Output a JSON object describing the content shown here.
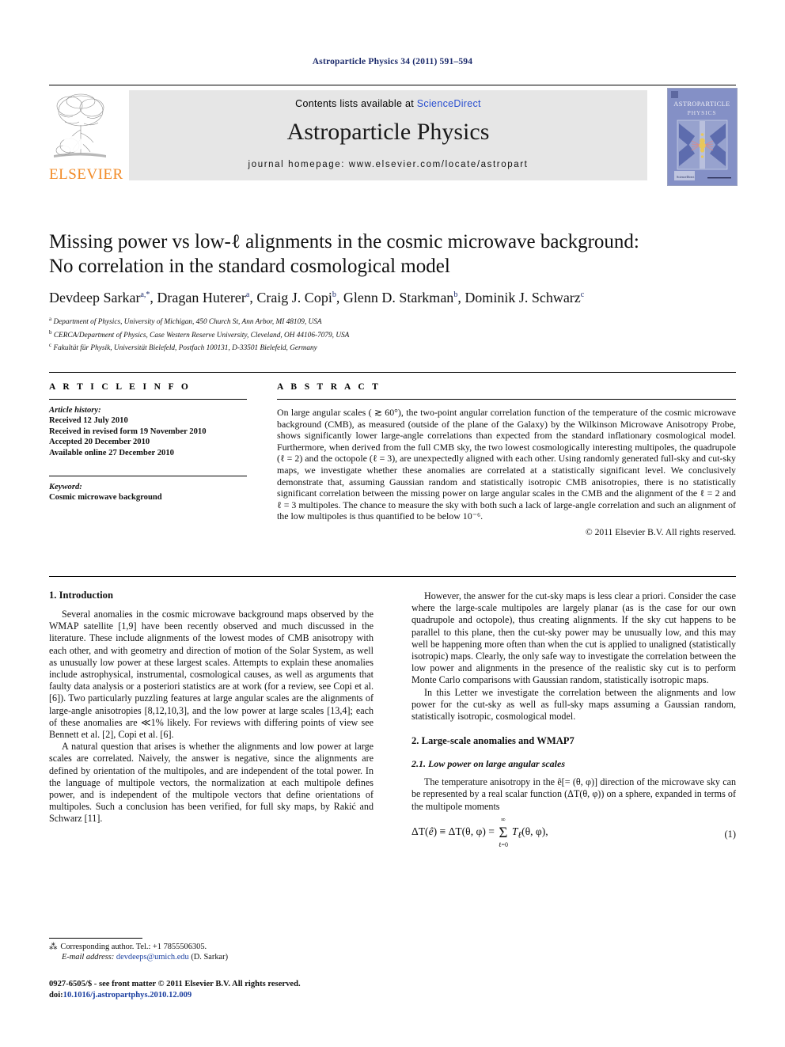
{
  "running_head": "Astroparticle Physics 34 (2011) 591–594",
  "masthead": {
    "publisher_name": "ELSEVIER",
    "contents_prefix": "Contents lists available at ",
    "contents_link": "ScienceDirect",
    "journal_title": "Astroparticle Physics",
    "homepage": "journal homepage: www.elsevier.com/locate/astropart",
    "cover_line1": "ASTROPARTICLE",
    "cover_line2": "PHYSICS",
    "cover_footer": "ScienceDirect"
  },
  "article": {
    "title_line1": "Missing power vs low-ℓ alignments in the cosmic microwave background:",
    "title_line2": "No correlation in the standard cosmological model",
    "authors": "Devdeep Sarkar, Dragan Huterer, Craig J. Copi, Glenn D. Starkman, Dominik J. Schwarz",
    "affiliations": [
      "Department of Physics, University of Michigan, 450 Church St, Ann Arbor, MI 48109, USA",
      "CERCA/Department of Physics, Case Western Reserve University, Cleveland, OH 44106-7079, USA",
      "Fakultät für Physik, Universität Bielefeld, Postfach 100131, D-33501 Bielefeld, Germany"
    ],
    "affiliation_marks": [
      "a",
      "b",
      "c"
    ]
  },
  "info": {
    "heading": "A R T I C L E    I N F O",
    "history_label": "Article history:",
    "history": [
      "Received 12 July 2010",
      "Received in revised form 19 November 2010",
      "Accepted 20 December 2010",
      "Available online 27 December 2010"
    ],
    "keyword_label": "Keyword:",
    "keywords": "Cosmic microwave background"
  },
  "abstract": {
    "heading": "A B S T R A C T",
    "text": "On large angular scales ( ≳ 60°), the two-point angular correlation function of the temperature of the cosmic microwave background (CMB), as measured (outside of the plane of the Galaxy) by the Wilkinson Microwave Anisotropy Probe, shows significantly lower large-angle correlations than expected from the standard inflationary cosmological model. Furthermore, when derived from the full CMB sky, the two lowest cosmologically interesting multipoles, the quadrupole (ℓ = 2) and the octopole (ℓ = 3), are unexpectedly aligned with each other. Using randomly generated full-sky and cut-sky maps, we investigate whether these anomalies are correlated at a statistically significant level. We conclusively demonstrate that, assuming Gaussian random and statistically isotropic CMB anisotropies, there is no statistically significant correlation between the missing power on large angular scales in the CMB and the alignment of the ℓ = 2 and ℓ = 3 multipoles. The chance to measure the sky with both such a lack of large-angle correlation and such an alignment of the low multipoles is thus quantified to be below 10⁻⁶.",
    "copyright": "© 2011 Elsevier B.V. All rights reserved."
  },
  "body": {
    "section1_heading": "1. Introduction",
    "left_paragraphs": [
      "Several anomalies in the cosmic microwave background maps observed by the WMAP satellite [1,9] have been recently observed and much discussed in the literature. These include alignments of the lowest modes of CMB anisotropy with each other, and with geometry and direction of motion of the Solar System, as well as unusually low power at these largest scales. Attempts to explain these anomalies include astrophysical, instrumental, cosmological causes, as well as arguments that faulty data analysis or a posteriori statistics are at work (for a review, see Copi et al. [6]). Two particularly puzzling features at large angular scales are the alignments of large-angle anisotropies [8,12,10,3], and the low power at large scales [13,4]; each of these anomalies are ≪1% likely. For reviews with differing points of view see Bennett et al. [2], Copi et al. [6].",
      "A natural question that arises is whether the alignments and low power at large scales are correlated. Naively, the answer is negative, since the alignments are defined by orientation of the multipoles, and are independent of the total power. In the language of multipole vectors, the normalization at each multipole defines power, and is independent of the multipole vectors that define orientations of multipoles. Such a conclusion has been verified, for full sky maps, by Rakić and Schwarz [11]."
    ],
    "right_paragraphs": [
      "However, the answer for the cut-sky maps is less clear a priori. Consider the case where the large-scale multipoles are largely planar (as is the case for our own quadrupole and octopole), thus creating alignments. If the sky cut happens to be parallel to this plane, then the cut-sky power may be unusually low, and this may well be happening more often than when the cut is applied to unaligned (statistically isotropic) maps. Clearly, the only safe way to investigate the correlation between the low power and alignments in the presence of the realistic sky cut is to perform Monte Carlo comparisons with Gaussian random, statistically isotropic maps.",
      "In this Letter we investigate the correlation between the alignments and low power for the cut-sky as well as full-sky maps assuming a Gaussian random, statistically isotropic, cosmological model."
    ],
    "section2_heading": "2. Large-scale anomalies and WMAP7",
    "subsection21_heading": "2.1. Low power on large angular scales",
    "paragraph_eq_intro": "The temperature anisotropy in the ê[= (θ, φ)] direction of the microwave sky can be represented by a real scalar function (ΔT(θ, φ)) on a sphere, expanded in terms of the multipole moments",
    "equation_1": "ΔT(ê) ≡ ΔT(θ, φ) = Σ Tℓ(θ, φ),",
    "equation_1_upper": "∞",
    "equation_1_lower": "ℓ=0",
    "equation_1_number": "(1)"
  },
  "footnotes": {
    "corresponding": "Corresponding author. Tel.: +1 7855506305.",
    "email_label": "E-mail address:",
    "email": "devdeeps@umich.edu",
    "email_owner": "(D. Sarkar)",
    "issn_line": "0927-6505/$ - see front matter © 2011 Elsevier B.V. All rights reserved.",
    "doi_label": "doi:",
    "doi": "10.1016/j.astropartphys.2010.12.009"
  },
  "colors": {
    "link": "#2a4fd0",
    "reference": "#1b2a6b",
    "elsevier_orange": "#f28b28",
    "masthead_grey": "#e6e6e6"
  }
}
